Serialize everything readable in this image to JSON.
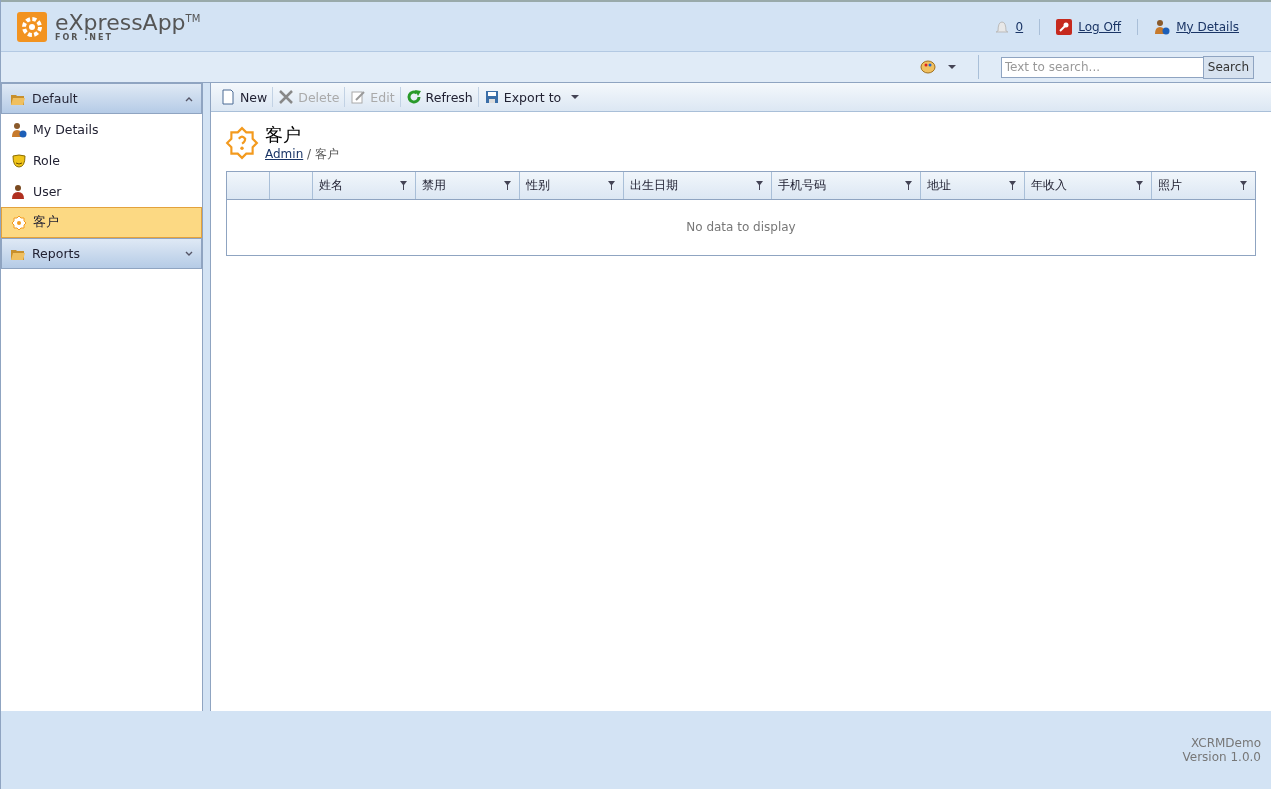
{
  "header": {
    "logo_text": "eXpressApp$^{TM}$",
    "logo_subtext": "FOR .NET",
    "notifications": "0",
    "links": [
      "Log Off",
      "My Details"
    ]
  },
  "search": {
    "placeholder": "Text to search...",
    "button": "Search"
  },
  "navigation": [
    {
      "label": "Default",
      "expanded": true,
      "items": [
        {
          "label": "My Details",
          "selected": false
        },
        {
          "label": "Role",
          "selected": false
        },
        {
          "label": "User",
          "selected": false
        },
        {
          "label": "客户",
          "selected": true
        }
      ]
    },
    {
      "label": "Reports",
      "expanded": false
    }
  ],
  "toolbar": [
    {
      "label": "New",
      "disabled": false,
      "dropdown": false
    },
    {
      "label": "Delete",
      "disabled": true,
      "dropdown": false
    },
    {
      "label": "Edit",
      "disabled": true,
      "dropdown": false
    },
    {
      "label": "Refresh",
      "disabled": false,
      "dropdown": false
    },
    {
      "label": "Export to",
      "disabled": false,
      "dropdown": true
    }
  ],
  "view": {
    "title": "客户",
    "breadcrumb": {
      "link": "Admin",
      "separator": "/",
      "current": "客户"
    }
  },
  "table": {
    "columns": [
      "姓名",
      "禁用",
      "性别",
      "出生日期",
      "手机号码",
      "地址",
      "年收入",
      "照片"
    ],
    "empty_text": "No data to display"
  },
  "footer": {
    "app_name": "XCRMDemo",
    "version": "Version 1.0.0"
  }
}
